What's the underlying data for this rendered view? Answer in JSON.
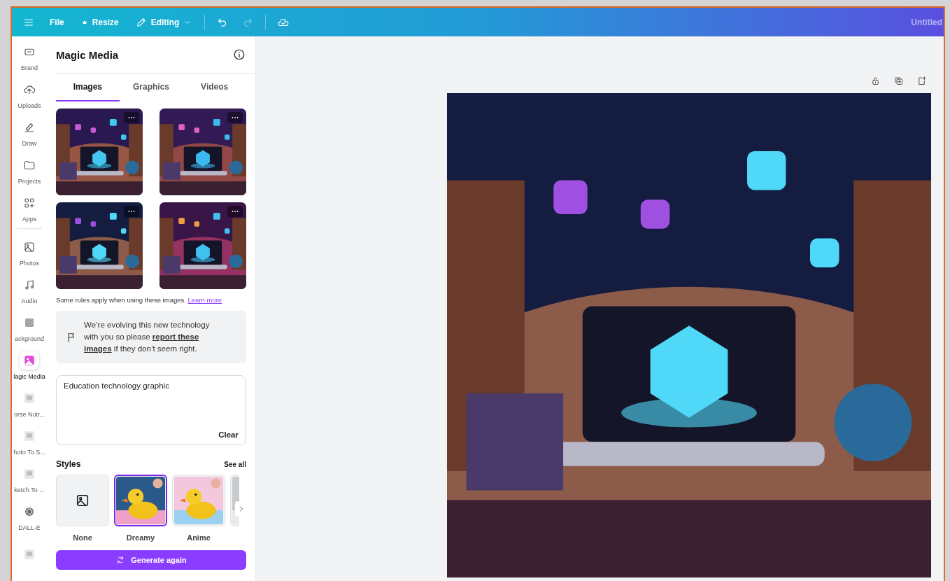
{
  "topbar": {
    "file": "File",
    "resize": "Resize",
    "mode": "Editing",
    "undo": {
      "disabled": false
    },
    "redo": {
      "disabled": true
    },
    "title": "Untitled"
  },
  "rail": {
    "groups": [
      [
        {
          "label": "Brand",
          "selected": false
        },
        {
          "label": "Uploads",
          "selected": false
        },
        {
          "label": "Draw",
          "selected": false
        },
        {
          "label": "Projects",
          "selected": false
        },
        {
          "label": "Apps",
          "selected": false
        }
      ],
      [
        {
          "label": "Photos",
          "selected": false
        },
        {
          "label": "Audio",
          "selected": false
        },
        {
          "label": "ackground",
          "selected": false
        },
        {
          "label": "lagic Media",
          "selected": true
        },
        {
          "label": "orse Nutr...",
          "selected": false
        },
        {
          "label": "hoto To S...",
          "selected": false
        },
        {
          "label": "ketch To ...",
          "selected": false
        },
        {
          "label": "DALL-E",
          "selected": false
        },
        {
          "selected": false
        }
      ]
    ]
  },
  "panel": {
    "title": "Magic Media",
    "tabs": [
      {
        "label": "Images",
        "selected": true
      },
      {
        "label": "Graphics",
        "selected": false
      },
      {
        "label": "Videos",
        "selected": false
      }
    ],
    "results": [
      {
        "kind": "picture"
      },
      {
        "kind": "picture"
      },
      {
        "kind": "picture"
      },
      {
        "kind": "picture"
      }
    ],
    "rules_note": "Some rules apply when using these images.",
    "learn_more": "Learn more",
    "notice": "We’re evolving this new technology with you so please **report these images** if they don’t seem right.",
    "prompt": {
      "value": "Education technology graphic",
      "clear": "Clear"
    },
    "styles": {
      "title": "Styles",
      "see_all": "See all",
      "items": [
        {
          "kind": "none",
          "label": "None",
          "selected": false
        },
        {
          "kind": "picture",
          "label": "Dreamy",
          "selected": true
        },
        {
          "kind": "picture",
          "label": "Anime",
          "selected": false
        },
        {
          "kind": "picture",
          "selected": false
        }
      ]
    },
    "generate": "Generate again"
  },
  "canvas": {
    "image": {
      "kind": "picture"
    }
  }
}
